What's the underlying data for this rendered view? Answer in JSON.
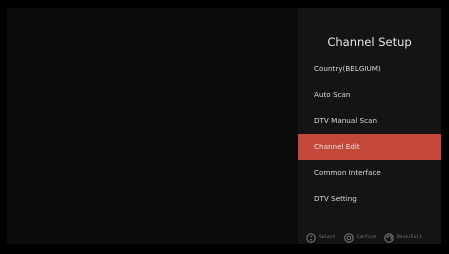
{
  "menu": {
    "title": "Channel Setup",
    "items": [
      {
        "label": "Country(BELGIUM)",
        "selected": false
      },
      {
        "label": "Auto Scan",
        "selected": false
      },
      {
        "label": "DTV Manual Scan",
        "selected": false
      },
      {
        "label": "Channel Edit",
        "selected": true
      },
      {
        "label": "Common Interface",
        "selected": false
      },
      {
        "label": "DTV Setting",
        "selected": false
      }
    ]
  },
  "hints": [
    {
      "icon": "dpad-icon",
      "label": "Select"
    },
    {
      "icon": "ok-button-icon",
      "label": "Confirm"
    },
    {
      "icon": "back-button-icon",
      "label": "Back/Exit"
    }
  ],
  "colors": {
    "background": "#000000",
    "menu_panel": "#141414",
    "selected_item": "#c4483a",
    "text": "#d9d9d9",
    "hint_text": "#7e7e7e"
  }
}
